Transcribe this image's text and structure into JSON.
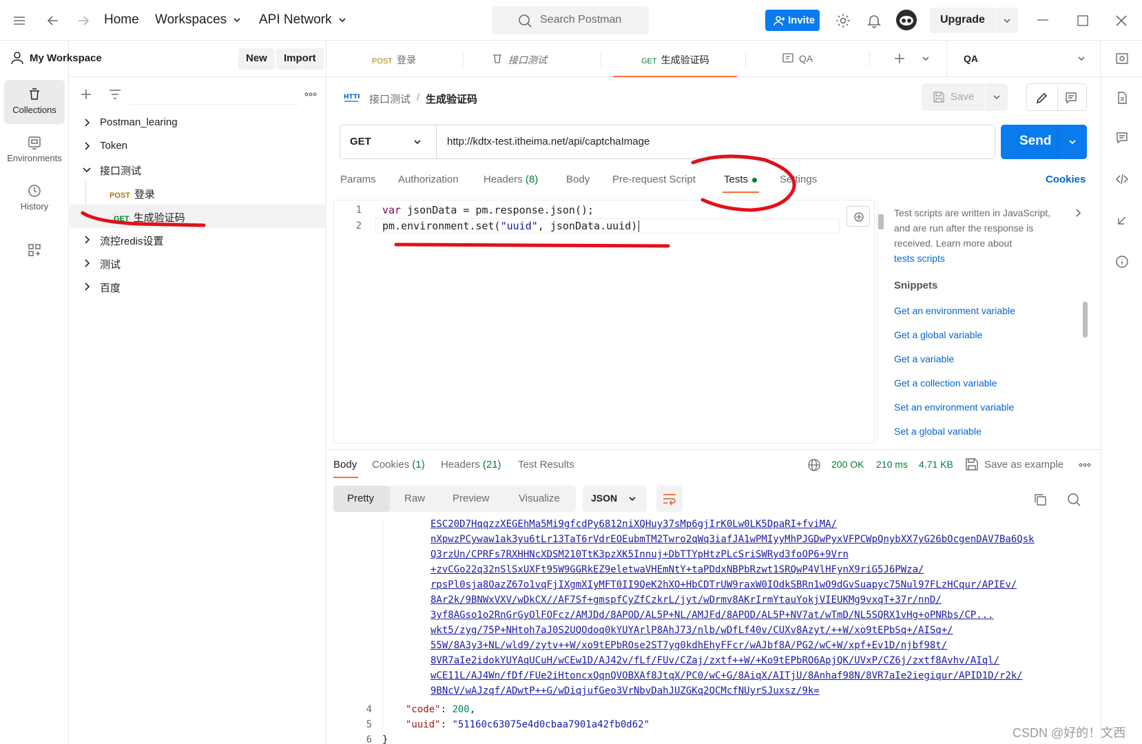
{
  "topbar": {
    "home": "Home",
    "workspaces": "Workspaces",
    "api_network": "API Network",
    "search_placeholder": "Search Postman",
    "invite": "Invite",
    "upgrade": "Upgrade"
  },
  "rail": {
    "collections": "Collections",
    "environments": "Environments",
    "history": "History"
  },
  "sidebar": {
    "workspace_title": "My Workspace",
    "new": "New",
    "import": "Import",
    "tree": [
      {
        "label": "Postman_learing"
      },
      {
        "label": "Token"
      },
      {
        "label": "接口测试"
      },
      {
        "method": "POST",
        "label": "登录"
      },
      {
        "method": "GET",
        "label": "生成验证码"
      },
      {
        "label": "流控redis设置"
      },
      {
        "label": "测试"
      },
      {
        "label": "百度"
      }
    ]
  },
  "tabs": [
    {
      "method": "POST",
      "label": "登录"
    },
    {
      "label": "接口测试"
    },
    {
      "method": "GET",
      "label": "生成验证码"
    },
    {
      "label": "QA"
    }
  ],
  "environment": "QA",
  "breadcrumb": {
    "parent": "接口测试",
    "sep": "/",
    "current": "生成验证码"
  },
  "save": "Save",
  "request": {
    "method": "GET",
    "url": "http://kdtx-test.itheima.net/api/captchaImage",
    "send": "Send"
  },
  "req_tabs": {
    "params": "Params",
    "authorization": "Authorization",
    "headers": "Headers",
    "headers_count": "(8)",
    "body": "Body",
    "pre_request": "Pre-request Script",
    "tests": "Tests",
    "settings": "Settings",
    "cookies": "Cookies"
  },
  "editor": {
    "line_numbers": [
      "1",
      "2"
    ],
    "line1_kw": "var",
    "line1_rest": " jsonData = pm.response.json();",
    "line2_a": "pm.environment.set(",
    "line2_str": "\"uuid\"",
    "line2_b": ", jsonData.uuid)"
  },
  "snippets": {
    "intro": "Test scripts are written in JavaScript, and are run after the response is received. Learn more about",
    "intro_link": "tests scripts",
    "title": "Snippets",
    "items": [
      "Get an environment variable",
      "Get a global variable",
      "Get a variable",
      "Get a collection variable",
      "Set an environment variable",
      "Set a global variable"
    ]
  },
  "response": {
    "tabs": {
      "body": "Body",
      "cookies": "Cookies",
      "cookies_count": "(1)",
      "headers": "Headers",
      "headers_count": "(21)",
      "test_results": "Test Results"
    },
    "status": "200 OK",
    "time": "210 ms",
    "size": "4.71 KB",
    "save_example": "Save as example",
    "views": [
      "Pretty",
      "Raw",
      "Preview",
      "Visualize"
    ],
    "format": "JSON",
    "img_lines": [
      "ESC20D7HqqzzXEGEhMa5Mi9gfcdPy6812niXQHuy37sMp6gjIrK0Lw0LK5DpaRI+fviMA/",
      "nXpwzPCywaw1ak3yu6tLr13TaT6rVdrEOEubmTM2Twro2qWq3iafJA1wPMIyyMhPJGDwPyxVFPCWpQnybXX7yG26bOcgenDAV7Ba6Qsk",
      "Q3rzUn/CPRFs7RXHHNcXDSM210TtK3pzXK5Innuj+DbTTYpHtzPLcSriSWRyd3foOP6+9Vrn",
      "+zvCGo22q32nSlSxUXFt95W9GGRkEZ9eletwaVHEmNtY+taPDdxNBPbRzwt1SRQwP4VlHFynX9riG5J6PWza/",
      "rpsPl0sja8OazZ67o1vqFjIXgmXIyMFT0II9QeK2hXO+HbCDTrUW9raxW0IOdkSBRn1wO9dGvSuapyc75Nul97FLzHCqur/APIEv/",
      "8Ar2k/9BNWxVXV/wDkCX//AF7Sf+gmspfCyZfCzkrL/jyt/wDrmv8AKrIrmYtauYokjVIEUKMg9vxqT+37r/nnD/",
      "3yf8AGso1o2RnGrGyOlFOFcz/AMJDd/8APOD/AL5P+NL/AMJFd/8APOD/AL5P+NV7at/wTmD/NL5SQRX1vHg+oPNRbs/CP...",
      "wkt5/zyg/75P+NHtoh7aJ0S2UQOdoq0kYUYArlP8AhJ73/nlb/wDfLf40v/CUXv8Azyt/++W/xo9tEPbSq+/AISq+/",
      "55W/8A3y3+NL/wld9/zytv++W/xo9tEPbROse2ST7yg0kdhEhyFFcr/wAJbf8A/PG2/wC+W/xpf+Ev1D/njbf98t/",
      "8VR7aIe2idokYUYAqUCuH/wCEw1D/AJ42v/fLf/FUv/CZaj/zxtf++W/+Ko9tEPbRO6ApjQK/UVxP/CZ6j/zxtf8Avhv/AIql/",
      "wCE11L/AJ4Wn/fDf/FUe2iHtoncxQqnQVOBXAf8JtqX/PC0/wC+G/8AiqX/AITjU/8Anhaf98N/8VR7aIe2iegiqur/APID1D/r2k/",
      "9BNcV/wAJzqf/ADwtP++G/wDiqjufGeo3VrNbvDahJUZGKq2QCMcfNUyrSJuxsz/9k="
    ],
    "code_key": "\"code\"",
    "code_val": "200",
    "uuid_key": "\"uuid\"",
    "uuid_val": "\"51160c63075e4d0cbaa7901a42fb0d62\"",
    "line_numbers": [
      "4",
      "5",
      "6"
    ],
    "closing": "}"
  },
  "watermark": "CSDN @好的！文西",
  "colors": {
    "accent_blue": "#097bed",
    "tab_orange": "#ff6c37",
    "get_green": "#007f31",
    "post_amber": "#ad7a03",
    "annotation_red": "#e0101a"
  }
}
